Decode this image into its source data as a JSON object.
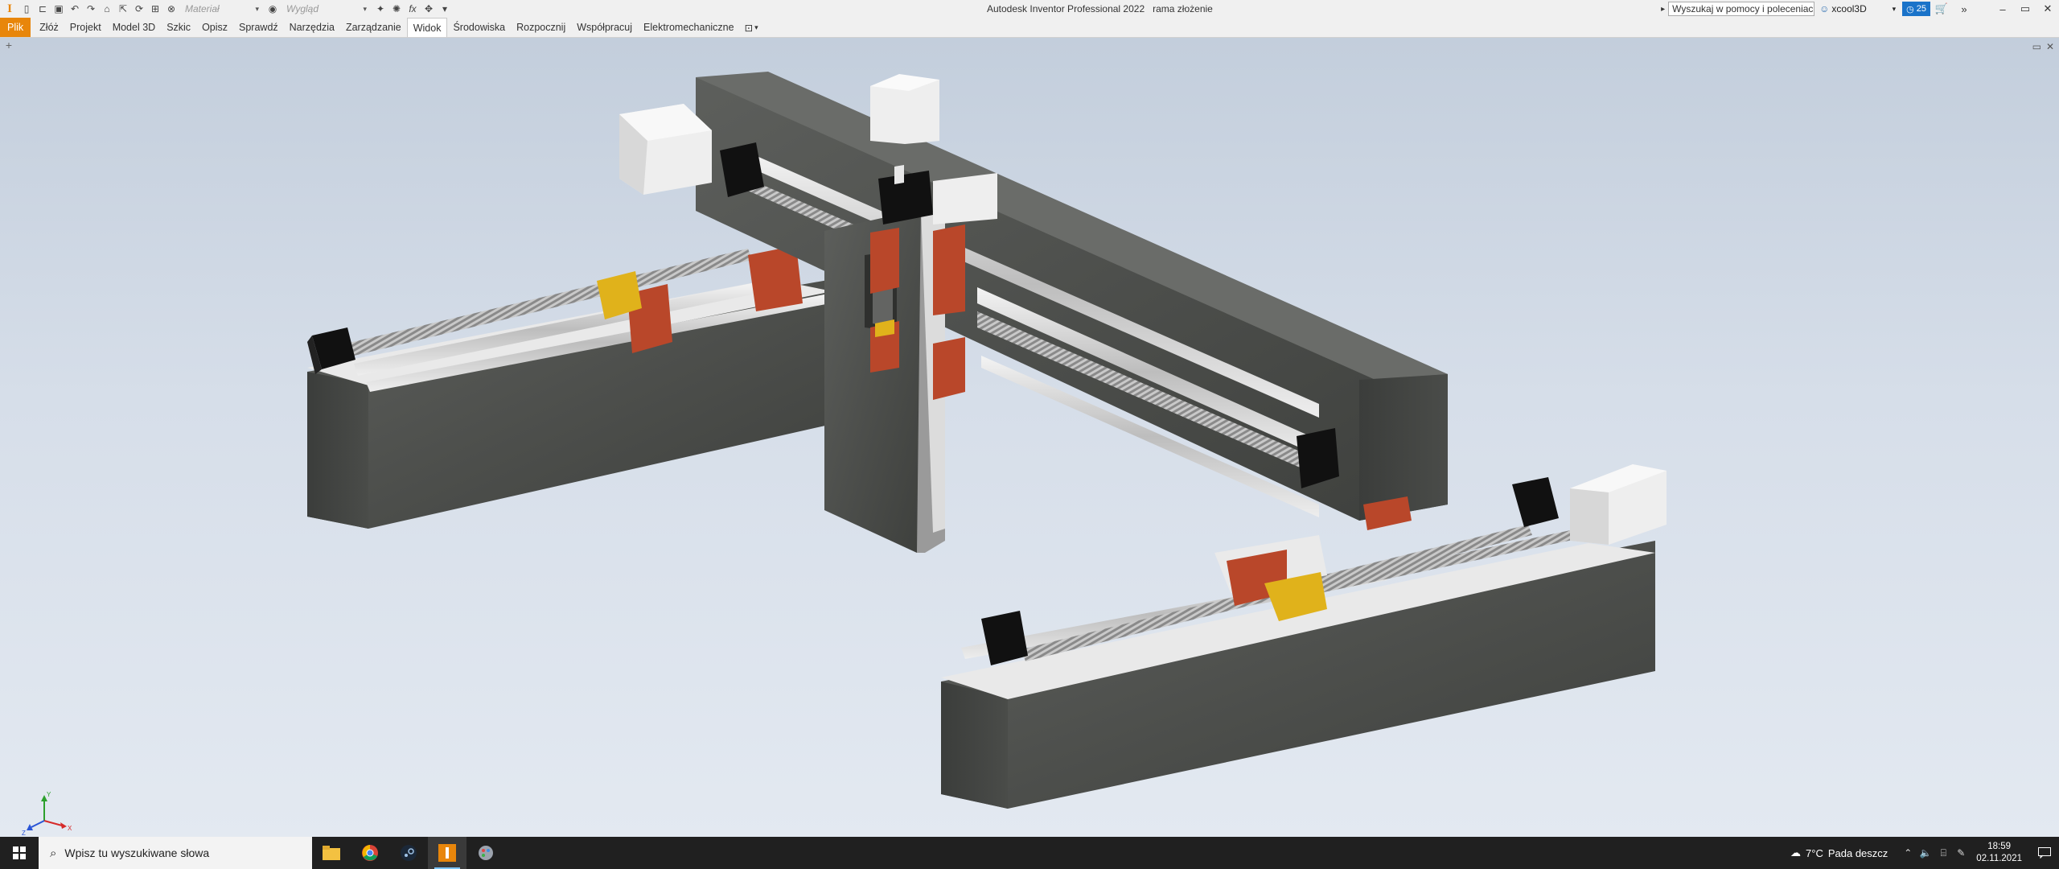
{
  "window": {
    "title_app": "Autodesk Inventor Professional 2022",
    "title_doc": "rama złożenie",
    "search_placeholder": "Wyszukaj w pomocy i poleceniach",
    "user_name": "xcool3D",
    "badge_count": "25",
    "material_placeholder": "Materiał",
    "appearance_placeholder": "Wygląd",
    "app_icon": "I"
  },
  "ribbon": {
    "tabs": [
      {
        "label": "Plik"
      },
      {
        "label": "Złóż"
      },
      {
        "label": "Projekt"
      },
      {
        "label": "Model 3D"
      },
      {
        "label": "Szkic"
      },
      {
        "label": "Opisz"
      },
      {
        "label": "Sprawdź"
      },
      {
        "label": "Narzędzia"
      },
      {
        "label": "Zarządzanie"
      },
      {
        "label": "Widok"
      },
      {
        "label": "Środowiska"
      },
      {
        "label": "Rozpocznij"
      },
      {
        "label": "Współpracuj"
      },
      {
        "label": "Elektromechaniczne"
      }
    ],
    "active_tab": "Widok"
  },
  "viewport": {
    "axes": {
      "x": "X",
      "y": "Y",
      "z": "Z"
    }
  },
  "taskbar": {
    "search_placeholder": "Wpisz tu wyszukiwane słowa",
    "weather_temp": "7°C",
    "weather_text": "Pada deszcz",
    "time": "18:59",
    "date": "02.11.2021"
  },
  "colors": {
    "accent_file": "#e8860b",
    "taskbar_bg": "#202020",
    "viewport_top": "#c3cedc",
    "viewport_bottom": "#e3e9f1"
  }
}
